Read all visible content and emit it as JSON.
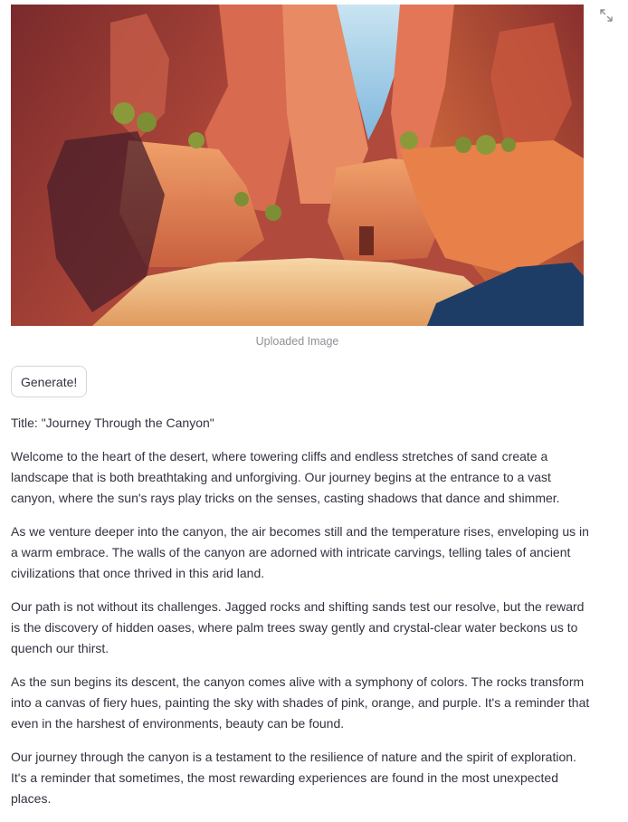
{
  "image": {
    "caption": "Uploaded Image",
    "alt": "Cartoon illustration of a red desert canyon"
  },
  "toolbar": {
    "generate_label": "Generate!"
  },
  "story": {
    "title": "Title: \"Journey Through the Canyon\"",
    "paragraphs": [
      "Welcome to the heart of the desert, where towering cliffs and endless stretches of sand create a landscape that is both breathtaking and unforgiving. Our journey begins at the entrance to a vast canyon, where the sun's rays play tricks on the senses, casting shadows that dance and shimmer.",
      "As we venture deeper into the canyon, the air becomes still and the temperature rises, enveloping us in a warm embrace. The walls of the canyon are adorned with intricate carvings, telling tales of ancient civilizations that once thrived in this arid land.",
      "Our path is not without its challenges. Jagged rocks and shifting sands test our resolve, but the reward is the discovery of hidden oases, where palm trees sway gently and crystal-clear water beckons us to quench our thirst.",
      "As the sun begins its descent, the canyon comes alive with a symphony of colors. The rocks transform into a canvas of fiery hues, painting the sky with shades of pink, orange, and purple. It's a reminder that even in the harshest of environments, beauty can be found.",
      "Our journey through the canyon is a testament to the resilience of nature and the spirit of exploration. It's a reminder that sometimes, the most rewarding experiences are found in the most unexpected places."
    ]
  },
  "icons": {
    "fullscreen": "fullscreen-expand-icon"
  },
  "colors": {
    "text": "#31333f",
    "caption": "#909096",
    "border": "#d6d6d9"
  }
}
